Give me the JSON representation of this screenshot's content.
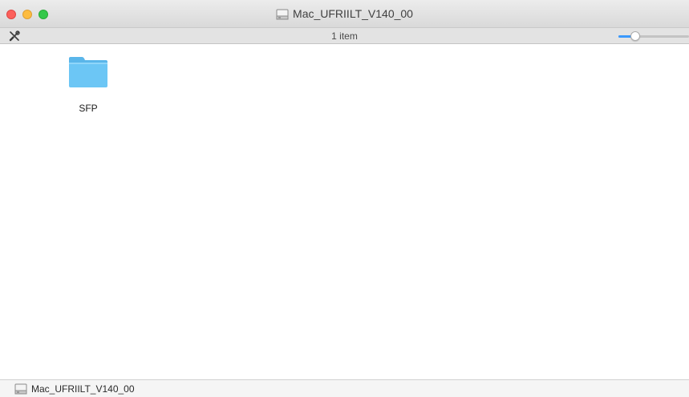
{
  "window": {
    "title": "Mac_UFRIILT_V140_00",
    "title_icon": "disk-icon"
  },
  "toolbar": {
    "tool_icon": "wrench-tools-icon",
    "item_count": "1 item",
    "icon_size_slider_level": 0.2
  },
  "content": {
    "items": [
      {
        "name": "SFP",
        "icon": "folder-icon"
      }
    ]
  },
  "pathbar": {
    "items": [
      {
        "label": "Mac_UFRIILT_V140_00",
        "icon": "disk-icon"
      }
    ]
  },
  "colors": {
    "close": "#fc605b",
    "minimize": "#fdbc40",
    "maximize": "#34c84a",
    "folder": "#6cc6f5",
    "slider_accent": "#3b99fc"
  }
}
